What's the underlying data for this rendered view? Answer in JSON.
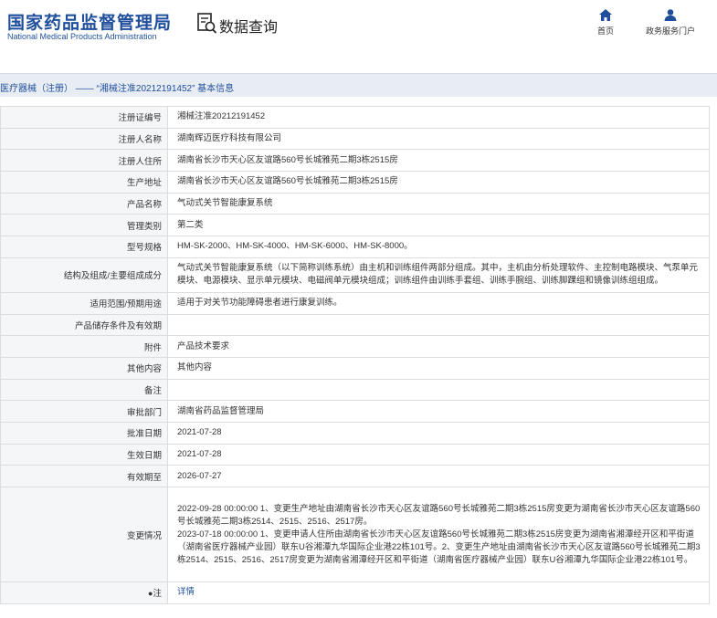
{
  "header": {
    "logo_cn": "国家药品监督管理局",
    "logo_en": "National Medical Products Administration",
    "query_title": "数据查询",
    "nav": [
      {
        "label": "首页",
        "icon": "home-icon"
      },
      {
        "label": "政务服务门户",
        "icon": "user-icon"
      }
    ],
    "brand_color": "#1f4f9c"
  },
  "breadcrumb": "医疗器械（注册） —— “湘械注准20212191452” 基本信息",
  "rows": [
    {
      "key": "注册证编号",
      "value": "湘械注准20212191452"
    },
    {
      "key": "注册人名称",
      "value": "湖南辉迈医疗科技有限公司"
    },
    {
      "key": "注册人住所",
      "value": "湖南省长沙市天心区友谊路560号长城雅苑二期3栋2515房"
    },
    {
      "key": "生产地址",
      "value": "湖南省长沙市天心区友谊路560号长城雅苑二期3栋2515房"
    },
    {
      "key": "产品名称",
      "value": "气动式关节智能康复系统"
    },
    {
      "key": "管理类别",
      "value": "第二类"
    },
    {
      "key": "型号规格",
      "value": "HM-SK-2000、HM-SK-4000、HM-SK-6000、HM-SK-8000。"
    },
    {
      "key": "结构及组成/主要组成成分",
      "value": "气动式关节智能康复系统（以下简称训练系统）由主机和训练组件两部分组成。其中，主机由分析处理软件、主控制电路模块、气泵单元模块、电源模块、显示单元模块、电磁阀单元模块组成；训练组件由训练手套组、训练手腕组、训练脚踝组和镜像训练组组成。"
    },
    {
      "key": "适用范围/预期用途",
      "value": "适用于对关节功能障碍患者进行康复训练。"
    },
    {
      "key": "产品储存条件及有效期",
      "value": ""
    },
    {
      "key": "附件",
      "value": "产品技术要求"
    },
    {
      "key": "其他内容",
      "value": "其他内容"
    },
    {
      "key": "备注",
      "value": ""
    },
    {
      "key": "审批部门",
      "value": "湖南省药品监督管理局"
    },
    {
      "key": "批准日期",
      "value": "2021-07-28"
    },
    {
      "key": "生效日期",
      "value": "2021-07-28"
    },
    {
      "key": "有效期至",
      "value": "2026-07-27"
    }
  ],
  "change": {
    "key": "变更情况",
    "entries": [
      "2022-09-28 00:00:00 1、变更生产地址由湖南省长沙市天心区友谊路560号长城雅苑二期3栋2515房变更为湖南省长沙市天心区友谊路560号长城雅苑二期3栋2514、2515、2516、2517房。",
      "2023-07-18 00:00:00 1、变更申请人住所由湖南省长沙市天心区友谊路560号长城雅苑二期3栋2515房变更为湖南省湘潭经开区和平街道（湖南省医疗器械产业园）联东U谷湘潭九华国际企业港22栋101号。2、变更生产地址由湖南省长沙市天心区友谊路560号长城雅苑二期3栋2514、2515、2516、2517房变更为湖南省湘潭经开区和平街道（湖南省医疗器械产业园）联东U谷湘潭九华国际企业港22栋101号。"
    ]
  },
  "note": {
    "pin": "●",
    "key": "注",
    "link": "详情"
  }
}
